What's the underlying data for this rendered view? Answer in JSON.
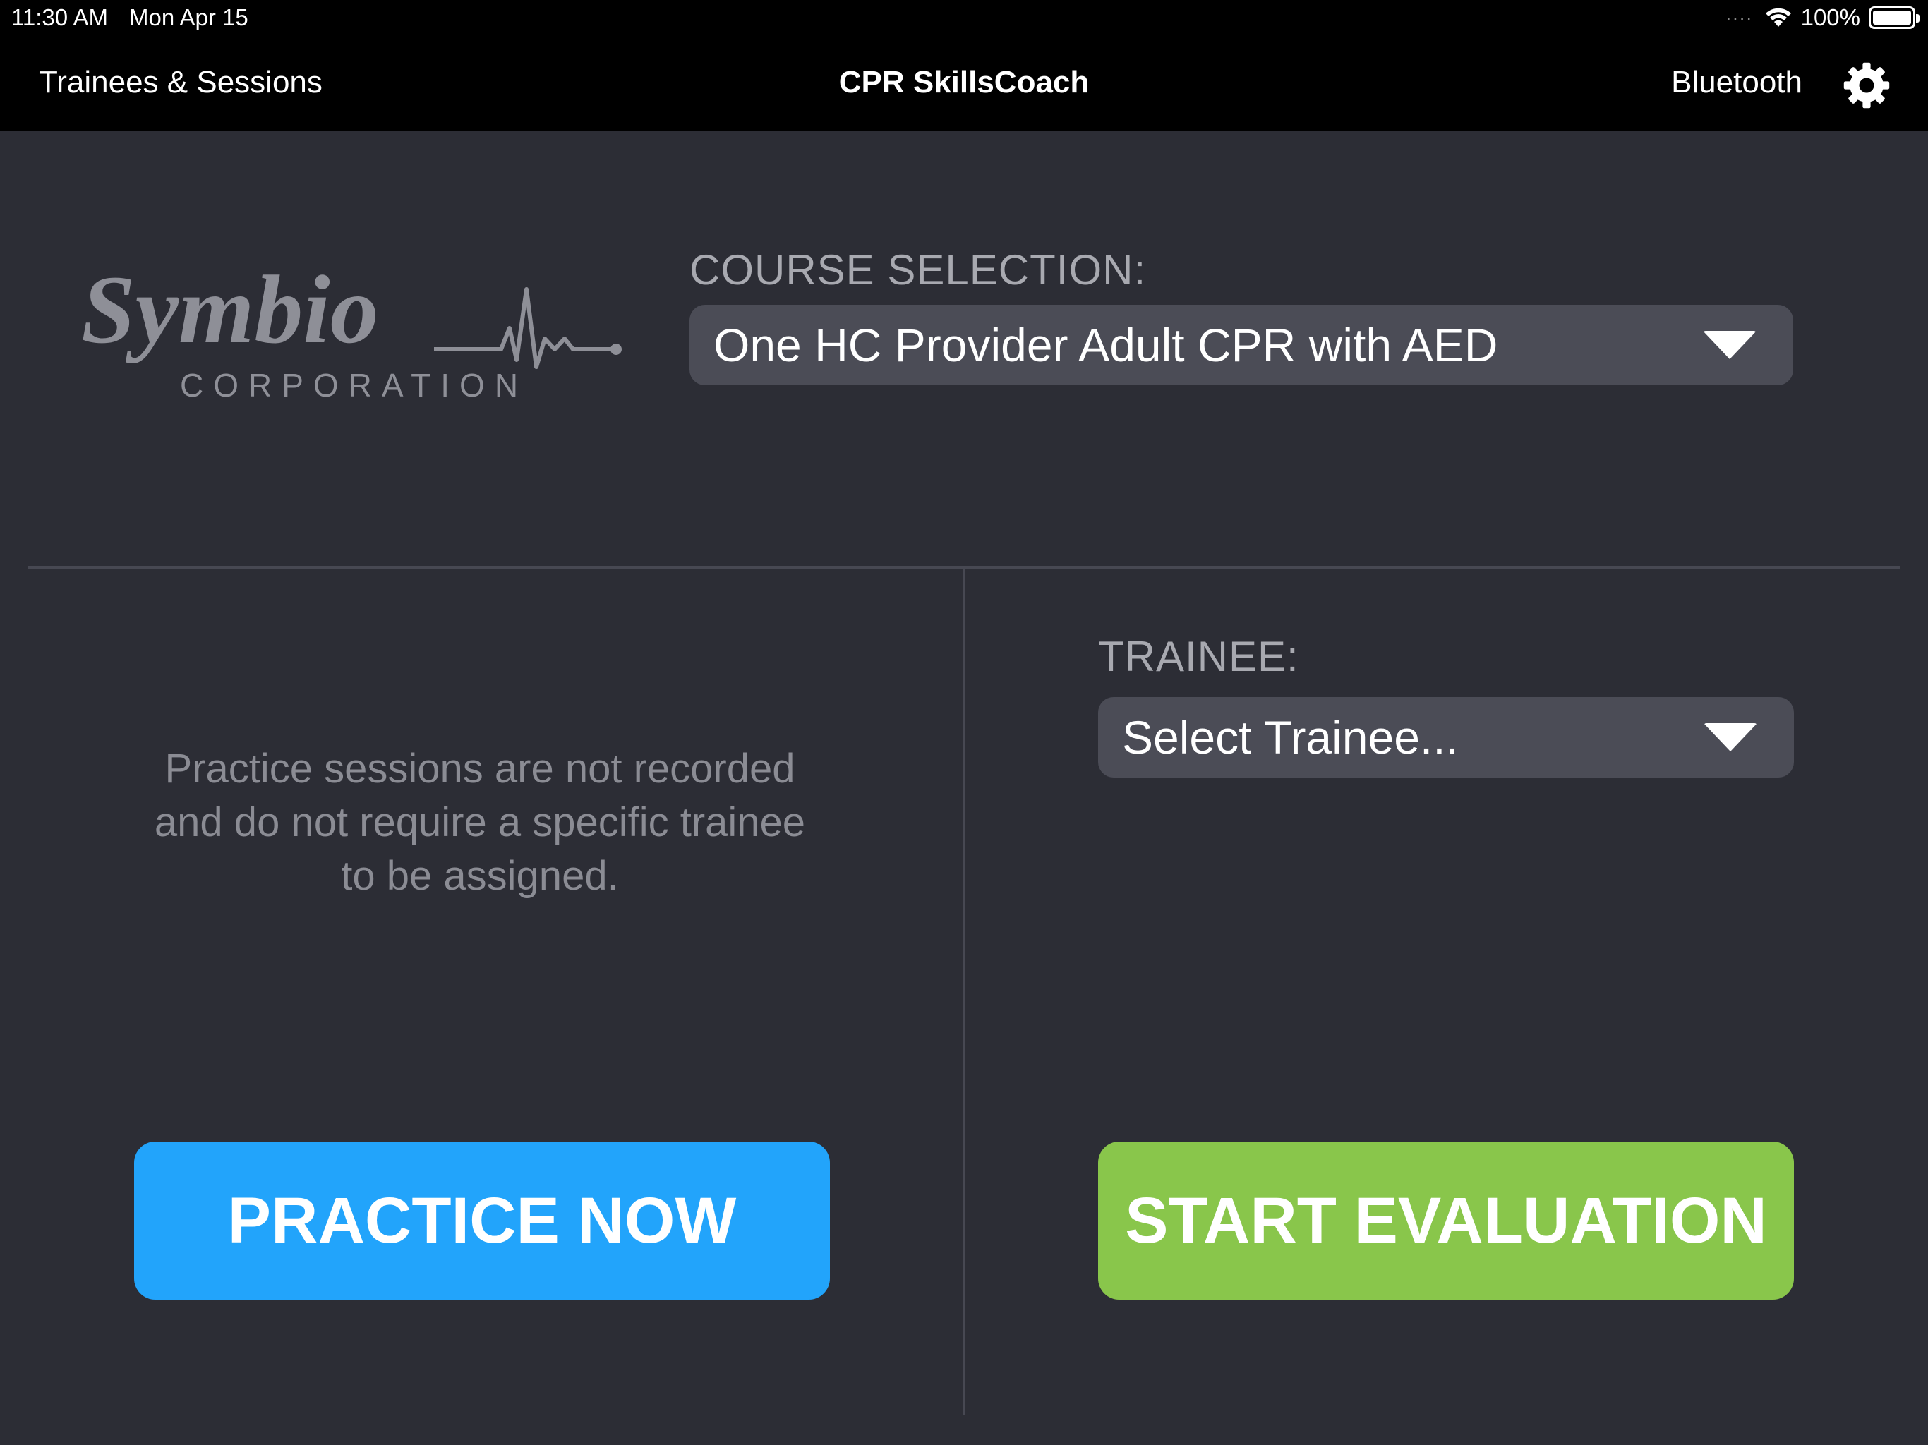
{
  "status_bar": {
    "time": "11:30 AM",
    "date": "Mon Apr 15",
    "battery": "100%"
  },
  "nav": {
    "left_label": "Trainees & Sessions",
    "title": "CPR SkillsCoach",
    "right_label": "Bluetooth"
  },
  "logo": {
    "brand": "Symbio",
    "subtitle": "CORPORATION"
  },
  "course": {
    "label": "COURSE SELECTION:",
    "selected": "One HC Provider Adult CPR with AED"
  },
  "trainee": {
    "label": "TRAINEE:",
    "selected": "Select Trainee..."
  },
  "practice": {
    "note": "Practice sessions are not recorded and do not require a specific trainee to be assigned.",
    "button_label": "PRACTICE NOW"
  },
  "evaluation": {
    "button_label": "START EVALUATION"
  },
  "colors": {
    "background": "#2c2d35",
    "practice_button": "#22a4fb",
    "evaluation_button": "#89c64b",
    "dropdown": "#4b4c56"
  }
}
